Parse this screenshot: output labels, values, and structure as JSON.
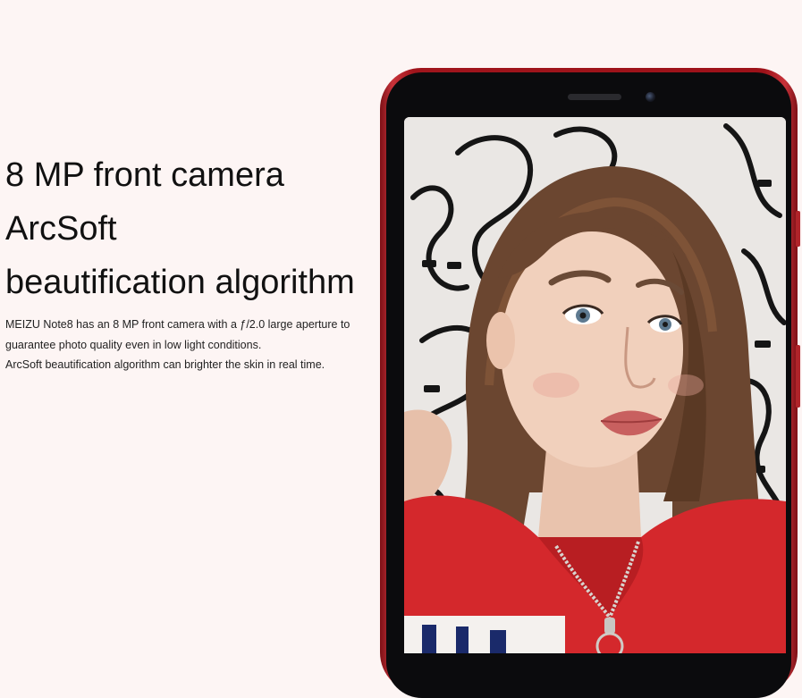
{
  "headline": {
    "lines": [
      "8 MP front camera",
      "ArcSoft",
      "beautification algorithm"
    ]
  },
  "description": {
    "lines": [
      "MEIZU Note8 has an 8 MP front camera with a ƒ/2.0 large aperture to",
      "guarantee photo quality even in low light conditions.",
      "ArcSoft beautification algorithm can brighter the skin in real time."
    ]
  },
  "colors": {
    "background": "#fdf5f4",
    "phone_body": "#a0151c",
    "hoodie": "#d4282c"
  }
}
